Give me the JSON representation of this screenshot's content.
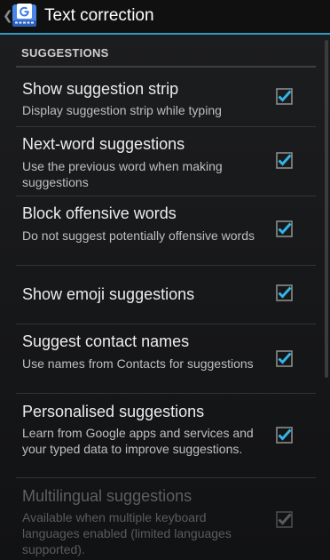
{
  "header": {
    "title": "Text correction",
    "app_icon": "google-keyboard-icon",
    "up_icon": "chevron-left-icon"
  },
  "section": {
    "label": "SUGGESTIONS"
  },
  "prefs": [
    {
      "title": "Show suggestion strip",
      "summary": "Display suggestion strip while typing",
      "checked": true,
      "enabled": true
    },
    {
      "title": "Next-word suggestions",
      "summary": "Use the previous word when making suggestions",
      "checked": true,
      "enabled": true
    },
    {
      "title": "Block offensive words",
      "summary": "Do not suggest potentially offensive words",
      "checked": true,
      "enabled": true
    },
    {
      "title": "Show emoji suggestions",
      "summary": "",
      "checked": true,
      "enabled": true
    },
    {
      "title": "Suggest contact names",
      "summary": "Use names from Contacts for suggestions",
      "checked": true,
      "enabled": true
    },
    {
      "title": "Personalised suggestions",
      "summary": "Learn from Google apps and services and your typed data to improve suggestions.",
      "checked": true,
      "enabled": true
    },
    {
      "title": "Multilingual suggestions",
      "summary": "Available when multiple keyboard languages enabled (limited languages supported).",
      "checked": true,
      "enabled": false
    }
  ],
  "colors": {
    "accent": "#2f9ac0",
    "check": "#33b5e5"
  }
}
